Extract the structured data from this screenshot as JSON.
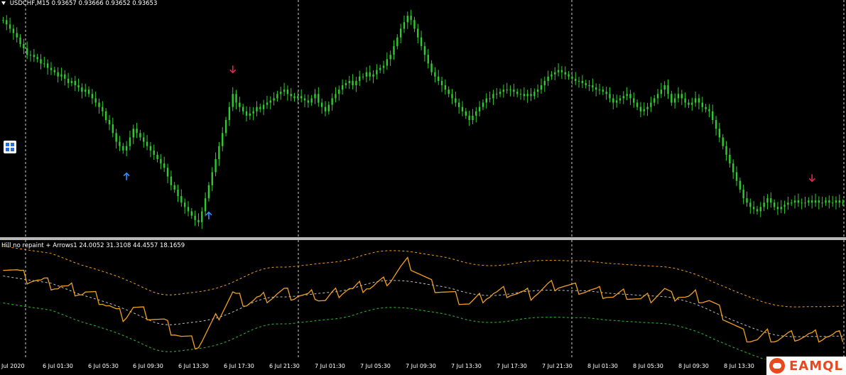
{
  "price_header": {
    "symbol": "USDCHF,M15",
    "open": "0.93657",
    "high": "0.93666",
    "low": "0.93652",
    "close": "0.93653"
  },
  "indicator_header": {
    "name": "Hill no repaint + Arrows1",
    "values": [
      "24.0052",
      "31.3108",
      "44.4557",
      "18.1659"
    ]
  },
  "time_axis": {
    "labels": [
      "Jul 2020",
      "6 Jul 01:30",
      "6 Jul 05:30",
      "6 Jul 09:30",
      "6 Jul 13:30",
      "6 Jul 17:30",
      "6 Jul 21:30",
      "7 Jul 01:30",
      "7 Jul 05:30",
      "7 Jul 09:30",
      "7 Jul 13:30",
      "7 Jul 17:30",
      "7 Jul 21:30",
      "8 Jul 01:30",
      "8 Jul 05:30",
      "8 Jul 09:30",
      "8 Jul 13:30"
    ]
  },
  "signals": {
    "buy": [
      {
        "index": 36
      },
      {
        "index": 60
      }
    ],
    "sell": [
      {
        "index": 67
      },
      {
        "index": 236
      }
    ]
  },
  "colors": {
    "background": "#000000",
    "candle": "#2ecc2e",
    "buy_arrow": "#2f8fff",
    "sell_arrow": "#e8244f",
    "oscillator": "#f0a020",
    "upper_band": "#f0a020",
    "middle_band": "#c0c0c0",
    "lower_band": "#2e9e2e",
    "separator": "#b8b8b8"
  },
  "chart_data": [
    {
      "type": "line",
      "title": "USDCHF,M15",
      "series": [
        {
          "name": "USDCHF",
          "note_values": "approximate M15 close levels in relative chart units (0 = lowest, 100 = highest visible)",
          "values": [
            96,
            94,
            92,
            90,
            88,
            85,
            83,
            80,
            80,
            79,
            78,
            76,
            76,
            74,
            73,
            72,
            70,
            71,
            69,
            67,
            68,
            66,
            65,
            63,
            64,
            62,
            60,
            58,
            56,
            54,
            50,
            48,
            44,
            40,
            38,
            36,
            38,
            42,
            46,
            44,
            42,
            40,
            38,
            36,
            34,
            32,
            30,
            28,
            24,
            20,
            18,
            15,
            12,
            10,
            8,
            6,
            4,
            3,
            8,
            14,
            20,
            26,
            32,
            38,
            44,
            50,
            56,
            62,
            58,
            56,
            54,
            52,
            53,
            54,
            56,
            55,
            57,
            58,
            59,
            60,
            62,
            63,
            64,
            62,
            61,
            60,
            61,
            60,
            59,
            58,
            60,
            62,
            58,
            56,
            54,
            57,
            60,
            62,
            64,
            66,
            67,
            68,
            66,
            68,
            70,
            70,
            72,
            70,
            71,
            73,
            74,
            75,
            78,
            80,
            84,
            88,
            92,
            95,
            98,
            96,
            92,
            88,
            84,
            80,
            76,
            72,
            70,
            68,
            66,
            64,
            62,
            60,
            58,
            56,
            54,
            52,
            50,
            52,
            54,
            56,
            58,
            60,
            60,
            62,
            62,
            63,
            64,
            64,
            64,
            63,
            62,
            62,
            61,
            62,
            61,
            63,
            64,
            66,
            68,
            70,
            71,
            72,
            73,
            72,
            71,
            70,
            69,
            68,
            68,
            67,
            66,
            66,
            65,
            64,
            64,
            63,
            62,
            60,
            58,
            59,
            60,
            61,
            62,
            60,
            58,
            56,
            54,
            55,
            56,
            58,
            60,
            62,
            64,
            66,
            62,
            58,
            60,
            62,
            60,
            58,
            57,
            58,
            60,
            58,
            56,
            55,
            54,
            50,
            46,
            42,
            38,
            34,
            30,
            26,
            22,
            18,
            14,
            12,
            10,
            9,
            8,
            10,
            12,
            14,
            12,
            10,
            9,
            10,
            11,
            12,
            12,
            13,
            12,
            12,
            12,
            13,
            12,
            13,
            12,
            12,
            13,
            12,
            12,
            13,
            12,
            12
          ]
        }
      ]
    },
    {
      "type": "line",
      "title": "Hill no repaint + Arrows1",
      "series": [
        {
          "name": "24.0052",
          "values": []
        },
        {
          "name": "31.3108",
          "values": []
        },
        {
          "name": "44.4557",
          "values": []
        },
        {
          "name": "18.1659",
          "values": []
        }
      ]
    }
  ]
}
